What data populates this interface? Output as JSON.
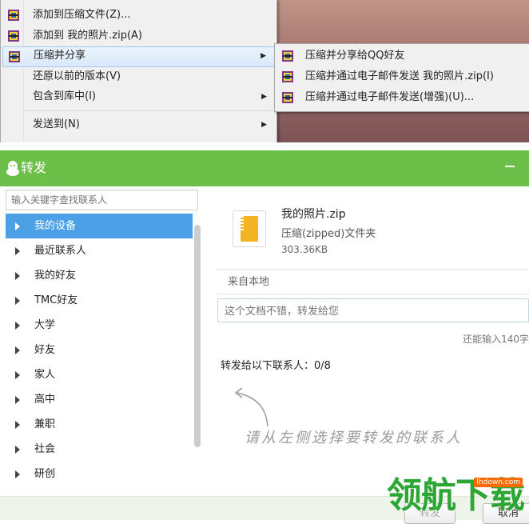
{
  "context_menu": {
    "items": [
      {
        "label": "添加到压缩文件(Z)...",
        "icon": "winrar-icon",
        "submenu": false
      },
      {
        "label": "添加到 我的照片.zip(A)",
        "icon": "winrar-icon",
        "submenu": false
      },
      {
        "label": "压缩并分享",
        "icon": "winrar-icon",
        "submenu": true,
        "highlighted": true
      },
      {
        "label": "还原以前的版本(V)",
        "icon": "",
        "submenu": false
      },
      {
        "label": "包含到库中(I)",
        "icon": "",
        "submenu": true
      },
      {
        "label": "发送到(N)",
        "icon": "",
        "submenu": true
      }
    ],
    "submenu_items": [
      {
        "label": "压缩并分享给QQ好友",
        "icon": "winrar-icon"
      },
      {
        "label": "压缩并通过电子邮件发送 我的照片.zip(I)",
        "icon": "winrar-icon"
      },
      {
        "label": "压缩并通过电子邮件发送(增强)(U)...",
        "icon": "winrar-icon"
      }
    ]
  },
  "window": {
    "title": "转发",
    "search": {
      "placeholder": "输入关键字查找联系人"
    },
    "groups": [
      {
        "label": "我的设备",
        "selected": true
      },
      {
        "label": "最近联系人"
      },
      {
        "label": "我的好友"
      },
      {
        "label": "TMC好友"
      },
      {
        "label": "大学"
      },
      {
        "label": "好友"
      },
      {
        "label": "家人"
      },
      {
        "label": "高中"
      },
      {
        "label": "兼职"
      },
      {
        "label": "社会"
      },
      {
        "label": "研创"
      }
    ],
    "file": {
      "name": "我的照片.zip",
      "type": "压缩(zipped)文件夹",
      "size": "303.36KB",
      "source": "来自本地"
    },
    "message": {
      "placeholder": "这个文档不错，转发给您"
    },
    "remaining": "还能输入140字",
    "recipients_count": "转发给以下联系人：0/8",
    "hint": "请从左侧选择要转发的联系人",
    "buttons": {
      "forward": "转发",
      "cancel": "取消"
    }
  },
  "watermark": {
    "main": "领航下载",
    "site": "lhdown.com"
  },
  "colors": {
    "titlebar": "#6cc04a",
    "selection": "#4ba0e6",
    "menu_highlight": "#d9e9f9"
  }
}
